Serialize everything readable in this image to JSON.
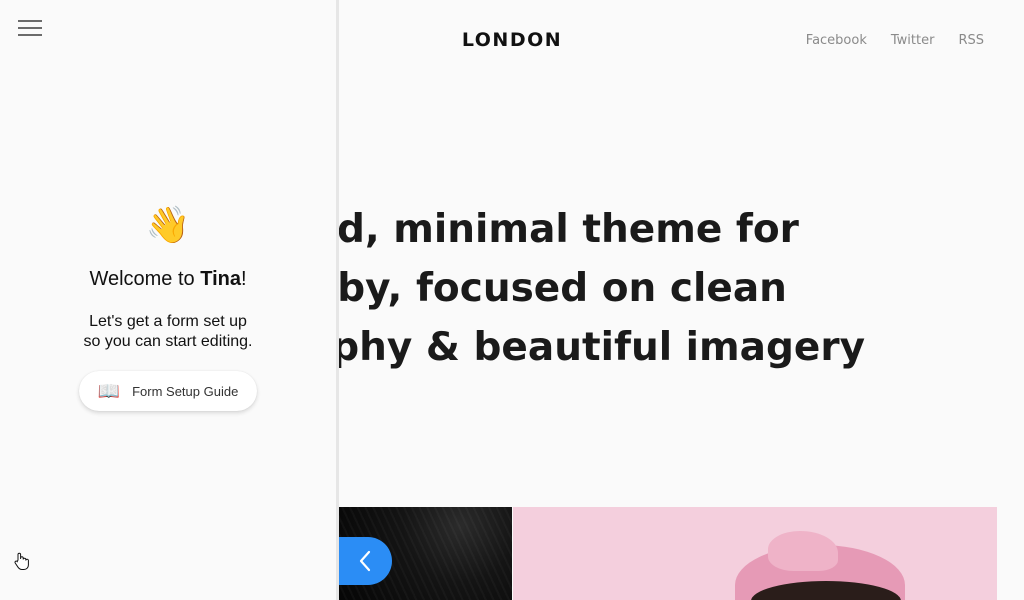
{
  "header": {
    "site_title": "LONDON",
    "social": [
      "Facebook",
      "Twitter",
      "RSS"
    ]
  },
  "hero": {
    "lines": [
      "A bold, minimal theme for",
      "Gatsby, focused on clean",
      "typography & beautiful imagery"
    ]
  },
  "sidebar": {
    "wave_emoji": "👋",
    "welcome_prefix": "Welcome to ",
    "welcome_brand": "Tina",
    "welcome_suffix": "!",
    "intro_line1": "Let's get a form set up",
    "intro_line2": "so you can start editing.",
    "guide_icon": "📖",
    "guide_label": "Form Setup Guide"
  },
  "carousel": {
    "prev_icon": "chevron-left-icon",
    "accent_color": "#2b8df5"
  }
}
